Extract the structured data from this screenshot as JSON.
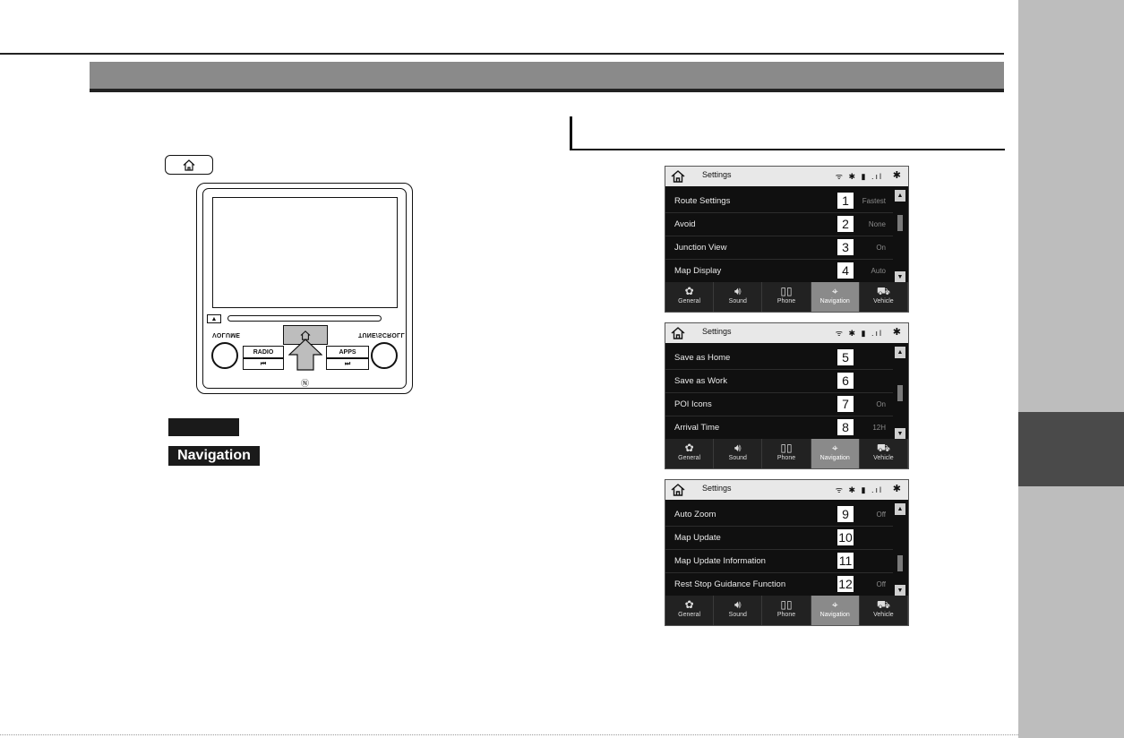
{
  "head_unit": {
    "left_knob_label": "VOLUME",
    "right_knob_label": "TUNE/SCROLL",
    "radio_label": "RADIO",
    "apps_label": "APPS",
    "prev_label": "⏮",
    "next_label": "⏭",
    "nfc_glyph": "Ⓝ",
    "eject_glyph": "▲"
  },
  "labels": {
    "dark_label": "",
    "navigation_label": "Navigation"
  },
  "screens": [
    {
      "title": "Settings",
      "status": "ᯤ ✱ ▮ .ıl",
      "bt": "✱",
      "rows": [
        {
          "label": "Route Settings",
          "num": "1",
          "value": "Fastest"
        },
        {
          "label": "Avoid",
          "num": "2",
          "value": "None"
        },
        {
          "label": "Junction View",
          "num": "3",
          "value": "On"
        },
        {
          "label": "Map Display",
          "num": "4",
          "value": "Auto"
        }
      ],
      "scroll_position": 0.25
    },
    {
      "title": "Settings",
      "status": "ᯤ ✱ ▮ .ıl",
      "bt": "✱",
      "rows": [
        {
          "label": "Save as Home",
          "num": "5",
          "value": ""
        },
        {
          "label": "Save as Work",
          "num": "6",
          "value": ""
        },
        {
          "label": "POI Icons",
          "num": "7",
          "value": "On"
        },
        {
          "label": "Arrival Time",
          "num": "8",
          "value": "12H"
        }
      ],
      "scroll_position": 0.5
    },
    {
      "title": "Settings",
      "status": "ᯤ ✱ ▮ .ıl",
      "bt": "✱",
      "rows": [
        {
          "label": "Auto Zoom",
          "num": "9",
          "value": "Off"
        },
        {
          "label": "Map Update",
          "num": "10",
          "value": ""
        },
        {
          "label": "Map Update Information",
          "num": "11",
          "value": ""
        },
        {
          "label": "Rest Stop Guidance Function",
          "num": "12",
          "value": "Off"
        }
      ],
      "scroll_position": 0.75
    }
  ],
  "tabs": [
    {
      "label": "General",
      "icon": "gear-icon",
      "glyph": "✿"
    },
    {
      "label": "Sound",
      "icon": "speaker-icon",
      "glyph": "🔊︎"
    },
    {
      "label": "Phone",
      "icon": "phone-icon",
      "glyph": "▯▯"
    },
    {
      "label": "Navigation",
      "icon": "map-pin-icon",
      "glyph": "⌖"
    },
    {
      "label": "Vehicle",
      "icon": "car-icon",
      "glyph": "⛟"
    }
  ],
  "active_tab": "Navigation"
}
